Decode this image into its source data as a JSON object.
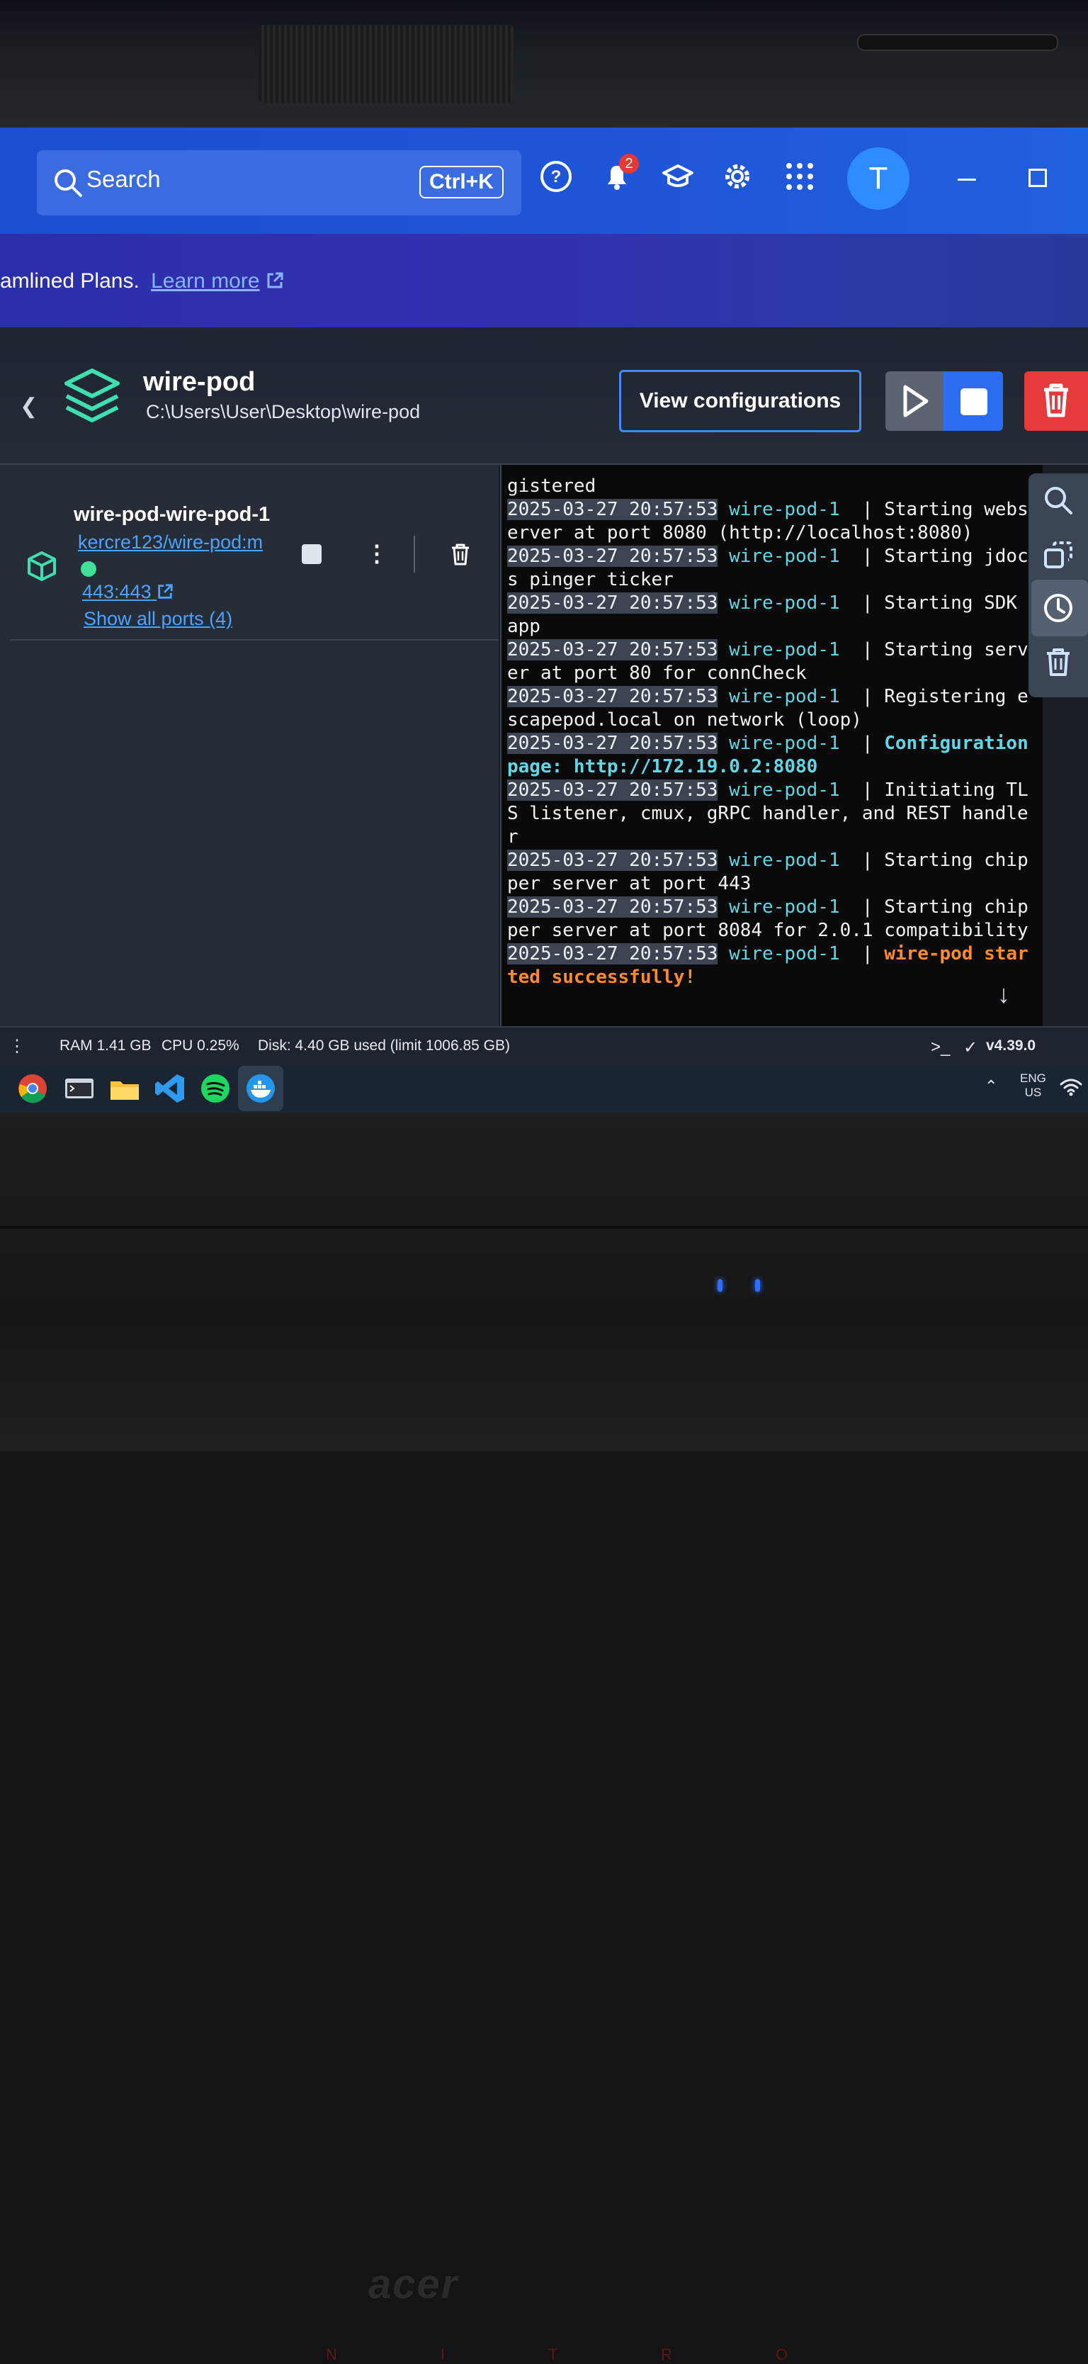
{
  "topbar": {
    "search_label": "Search",
    "shortcut": "Ctrl+K",
    "notification_count": "2",
    "avatar_initial": "T"
  },
  "banner": {
    "text": "amlined Plans.",
    "link": "Learn more"
  },
  "project": {
    "name": "wire-pod",
    "path": "C:\\Users\\User\\Desktop\\wire-pod",
    "view_config_label": "View configurations"
  },
  "container": {
    "name": "wire-pod-wire-pod-1",
    "image": "kercre123/wire-pod:m",
    "port": "443:443",
    "show_ports": "Show all ports (4)",
    "status_color": "#3ee09a"
  },
  "logs": [
    {
      "ts": "",
      "svc": "",
      "msg": "gistered"
    },
    {
      "ts": "2025-03-27 20:57:53",
      "svc": "wire-pod-1",
      "msg": "Starting webserver at port 8080 (http://localhost:8080)"
    },
    {
      "ts": "2025-03-27 20:57:53",
      "svc": "wire-pod-1",
      "msg": "Starting jdocs pinger ticker"
    },
    {
      "ts": "2025-03-27 20:57:53",
      "svc": "wire-pod-1",
      "msg": "Starting SDK app"
    },
    {
      "ts": "2025-03-27 20:57:53",
      "svc": "wire-pod-1",
      "msg": "Starting server at port 80 for connCheck"
    },
    {
      "ts": "2025-03-27 20:57:53",
      "svc": "wire-pod-1",
      "msg": "Registering escapepod.local on network (loop)"
    },
    {
      "ts": "2025-03-27 20:57:53",
      "svc": "wire-pod-1",
      "msg": "Configuration page: http://172.19.0.2:8080",
      "style": "cfg"
    },
    {
      "ts": "2025-03-27 20:57:53",
      "svc": "wire-pod-1",
      "msg": "Initiating TLS listener, cmux, gRPC handler, and REST handler"
    },
    {
      "ts": "2025-03-27 20:57:53",
      "svc": "wire-pod-1",
      "msg": "Starting chipper server at port 443"
    },
    {
      "ts": "2025-03-27 20:57:53",
      "svc": "wire-pod-1",
      "msg": "Starting chipper server at port 8084 for 2.0.1 compatibility"
    },
    {
      "ts": "2025-03-27 20:57:53",
      "svc": "wire-pod-1",
      "msg": "wire-pod started successfully!",
      "style": "ok"
    }
  ],
  "statusbar": {
    "ram": "RAM 1.41 GB",
    "cpu": "CPU 0.25%",
    "disk": "Disk: 4.40 GB used (limit 1006.85 GB)",
    "version": "v4.39.0"
  },
  "taskbar": {
    "lang_top": "ENG",
    "lang_bottom": "US",
    "apps": [
      "chrome-icon",
      "terminal-icon",
      "file-explorer-icon",
      "vscode-icon",
      "spotify-icon",
      "docker-icon"
    ]
  },
  "laptop": {
    "brand": "acer",
    "model": "N I T R O"
  }
}
